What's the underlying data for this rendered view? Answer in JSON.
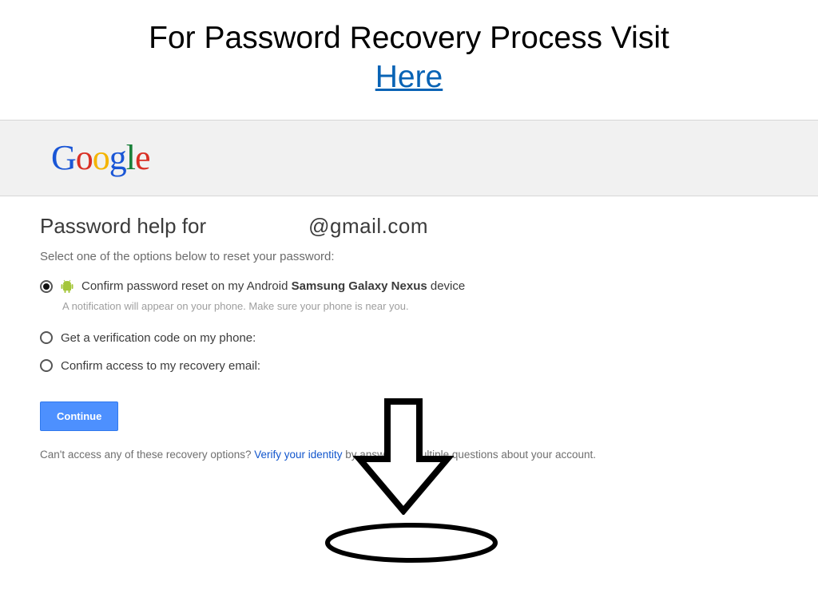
{
  "slide": {
    "title_text": "For Password Recovery Process Visit",
    "here_link": "Here"
  },
  "logo": {
    "letters": [
      "G",
      "o",
      "o",
      "g",
      "l",
      "e"
    ]
  },
  "page": {
    "heading_prefix": "Password help for",
    "email_suffix": "@gmail.com",
    "instruction": "Select one of the options below to reset your password:"
  },
  "options": [
    {
      "pre": "Confirm password reset on my Android ",
      "bold": "Samsung Galaxy Nexus",
      "post": " device",
      "sub": "A notification will appear on your phone. Make sure your phone is near you.",
      "selected": true,
      "icon": "android"
    },
    {
      "pre": "Get a verification code on my phone:",
      "bold": "",
      "post": "",
      "sub": "",
      "selected": false,
      "icon": ""
    },
    {
      "pre": "Confirm access to my recovery email:",
      "bold": "",
      "post": "",
      "sub": "",
      "selected": false,
      "icon": ""
    }
  ],
  "buttons": {
    "continue": "Continue"
  },
  "footer": {
    "pre": "Can't access any of these recovery options? ",
    "link": "Verify your identity",
    "post": " by answering multiple questions about your account."
  }
}
